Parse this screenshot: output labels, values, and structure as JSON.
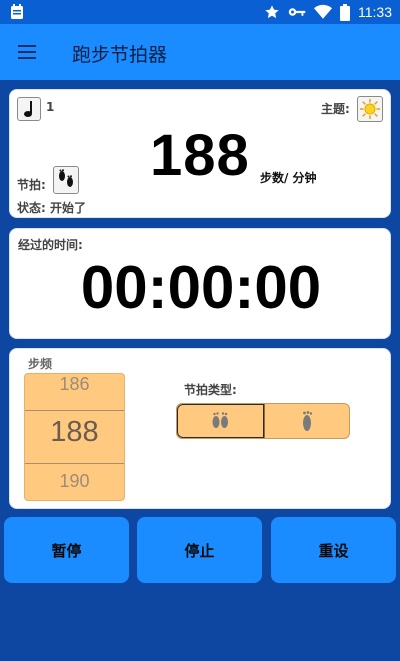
{
  "status_bar": {
    "time": "11:33",
    "icons": [
      "app-notification-icon",
      "star-icon",
      "key-icon",
      "wifi-icon",
      "battery-icon"
    ]
  },
  "app_bar": {
    "menu_icon": "hamburger-menu-icon",
    "title": "跑步节拍器"
  },
  "info_card": {
    "note_count": "1",
    "theme_label": "主题:",
    "theme_icon": "sun-icon",
    "bpm_value": "188",
    "bpm_unit": "步数/ 分钟",
    "beat_label": "节拍:",
    "beat_icon": "footprints-icon",
    "status_label": "状态: 开始了"
  },
  "timer_card": {
    "label": "经过的时间:",
    "value": "00:00:00"
  },
  "cadence_card": {
    "label": "步频",
    "picker": {
      "prev": "186",
      "current": "188",
      "next": "190"
    },
    "beat_type_label": "节拍类型:",
    "beat_type_options": [
      "both-feet-icon",
      "single-foot-icon"
    ],
    "selected_option": 0
  },
  "buttons": {
    "pause": "暂停",
    "stop": "停止",
    "reset": "重设"
  },
  "colors": {
    "status_bar": "#0a5fd2",
    "app_bar": "#1a8cff",
    "background": "#0d47a1",
    "picker_fill": "#ffc980",
    "button_fill": "#1a8cff"
  }
}
